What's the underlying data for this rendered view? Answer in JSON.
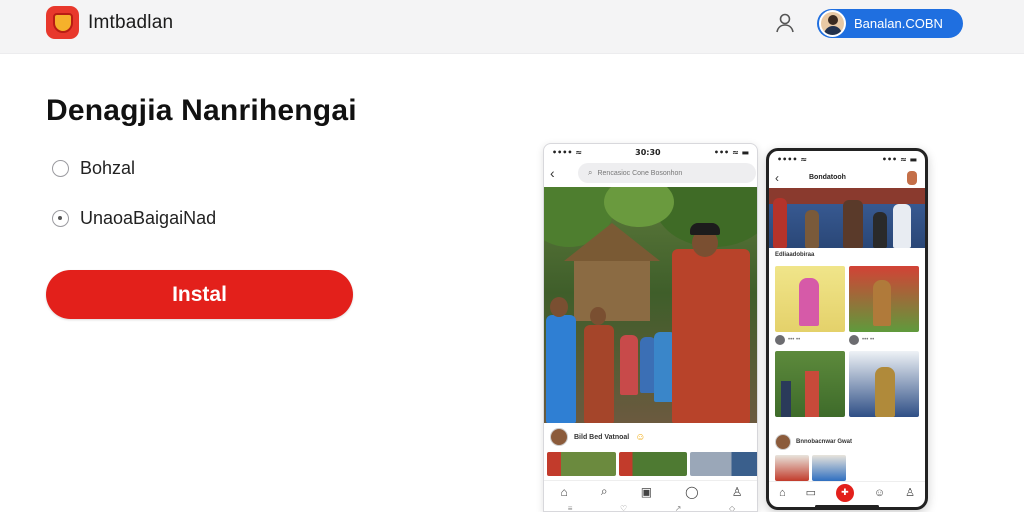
{
  "header": {
    "brand": "Imtbadlan",
    "account_label": "Banalan.COBN",
    "icons": {
      "logo": "shield-logo-icon",
      "user": "person-outline-icon"
    }
  },
  "main": {
    "headline": "Denagjia Nanrihengai",
    "options": [
      {
        "label": "Bohzal",
        "selected": false
      },
      {
        "label": "UnaoaBaigaiNad",
        "selected": true
      }
    ],
    "install_label": "Instal"
  },
  "phone1": {
    "status_time": "30:30",
    "status_left": "•••• ≈",
    "status_right": "••• ≈ ▬",
    "search_placeholder": "Rencasioc Cone Bosonhon",
    "caption": "Bild Bed Vatnoal",
    "nav_icons": [
      "home-icon",
      "search-icon",
      "grid-icon",
      "message-icon",
      "profile-icon"
    ]
  },
  "phone2": {
    "status_left": "•••• ≈",
    "status_right": "••• ≈ ▬",
    "title": "Bondatooh",
    "section_label": "Edliaadobiraa",
    "card_meta": "••• ••",
    "author": "Bnnobacnwar Gwat",
    "nav_icons": [
      "home-icon",
      "bag-icon",
      "add-icon",
      "smile-icon",
      "profile-icon"
    ]
  },
  "colors": {
    "accent_red": "#e3201b",
    "accent_blue": "#1f6fe0",
    "header_bg": "#f4f4f5"
  }
}
